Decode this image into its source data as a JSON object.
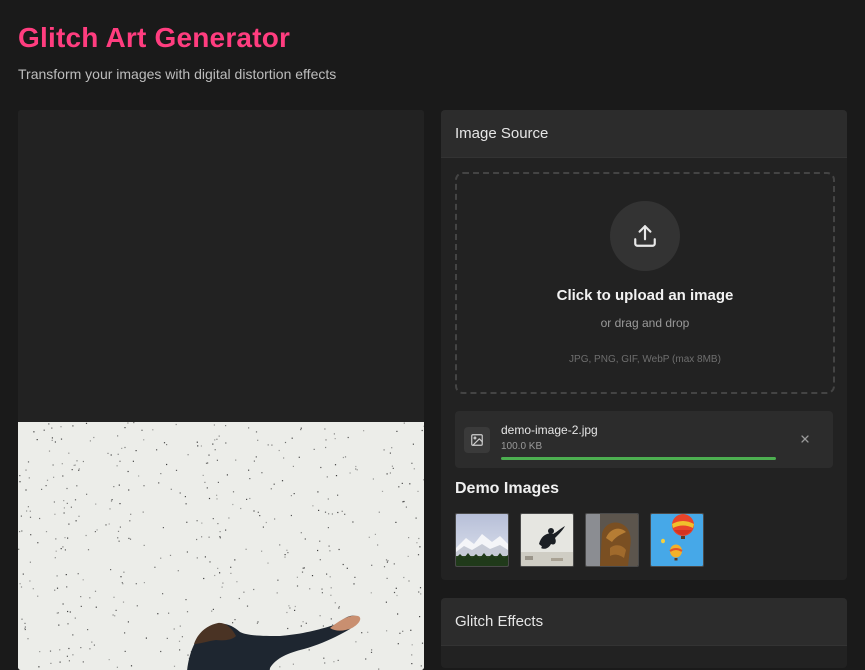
{
  "app": {
    "title": "Glitch Art Generator",
    "subtitle": "Transform your images with digital distortion effects"
  },
  "source_panel": {
    "title": "Image Source",
    "dropzone": {
      "icon": "upload-icon",
      "title": "Click to upload an image",
      "subtitle": "or drag and drop",
      "formats": "JPG, PNG, GIF, WebP (max 8MB)"
    },
    "file": {
      "icon": "image-icon",
      "name": "demo-image-2.jpg",
      "size": "100.0 KB",
      "progress": 1.0,
      "remove_icon": "close-icon"
    },
    "demo": {
      "title": "Demo Images",
      "items": [
        {
          "icon": "snowy-mountains-thumbnail"
        },
        {
          "icon": "jumping-person-thumbnail"
        },
        {
          "icon": "bronze-sculpture-thumbnail"
        },
        {
          "icon": "hot-air-balloons-thumbnail"
        }
      ]
    }
  },
  "effects_panel": {
    "title": "Glitch Effects"
  },
  "colors": {
    "accent": "#ff3d7f",
    "background": "#1a1a1a",
    "panel": "#222222",
    "progress": "#4caf50"
  }
}
